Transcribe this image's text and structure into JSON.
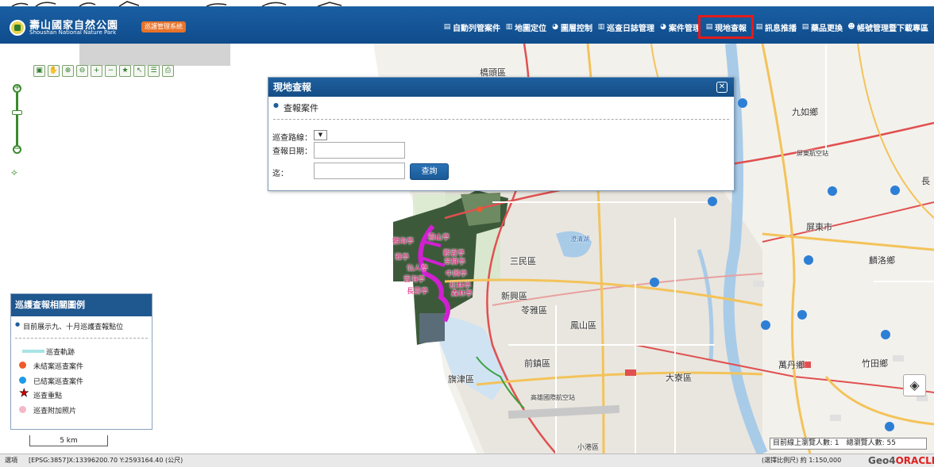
{
  "header": {
    "logo_title": "壽山國家自然公園",
    "logo_sub": "Shoushan National Nature Park",
    "system_badge": "巡護管理系統",
    "nav": [
      {
        "label": "自動列管案件",
        "icon": "document-icon"
      },
      {
        "label": "地圖定位",
        "icon": "bar-chart-icon"
      },
      {
        "label": "圖層控制",
        "icon": "pie-chart-icon"
      },
      {
        "label": "巡查日誌管理",
        "icon": "bar-chart-icon"
      },
      {
        "label": "案件管理",
        "icon": "pie-chart-icon"
      },
      {
        "label": "現地查報",
        "icon": "document-icon",
        "active": true
      },
      {
        "label": "訊息推播",
        "icon": "document-icon"
      },
      {
        "label": "藥品更換",
        "icon": "document-icon"
      },
      {
        "label": "帳號管理暨下載專區",
        "icon": "users-icon"
      }
    ]
  },
  "map": {
    "labels": {
      "qiaotou": "橋頭區",
      "jiuru": "九如鄉",
      "pingdong_airport": "屏東航空站",
      "chang": "長",
      "pingdong_city": "屏東市",
      "linluo": "麟洛鄉",
      "sanmin": "三民區",
      "xinxing": "新興區",
      "lingya": "苓雅區",
      "fengshan": "鳳山區",
      "qianzhen": "前鎮區",
      "cijin": "旗津區",
      "daliao": "大寮區",
      "wandan": "萬丹鄉",
      "zhutian": "竹田鄉",
      "kaohsiung_airport": "高雄國際航空站",
      "xiaogang": "小港區",
      "cheng": "澄清湖",
      "pavilions": [
        "觀海亭",
        "壽山亭",
        "雅亭",
        "觀雲亭",
        "仙人亭",
        "翠屏亭",
        "雲海亭",
        "中興亭",
        "長壽亭",
        "松林亭",
        "森林亭"
      ]
    }
  },
  "toolbar": {
    "tools": [
      "select-icon",
      "pan-icon",
      "zoom-in-icon",
      "zoom-out-icon",
      "plus-icon",
      "minus-icon",
      "bookmark-icon",
      "pointer-icon",
      "layers-icon",
      "print-icon"
    ]
  },
  "dialog": {
    "title": "現地查報",
    "close_symbol": "✕",
    "subtitle": "查報案件",
    "route_label": "巡查路線：",
    "route_value": "▼",
    "date_label": "查報日期：",
    "date_value": "",
    "to_label": "迄：",
    "to_value": "",
    "query_button": "查詢"
  },
  "legend": {
    "title": "巡護查報相關圖例",
    "note": "目前展示九、十月巡護查報點位",
    "items": [
      "巡查軌跡",
      "未結案巡查案件",
      "已結案巡查案件",
      "巡查重點",
      "巡查附加照片"
    ],
    "colors": {
      "track": "#a8e4e4",
      "open": "#f05a28",
      "closed": "#1e9be8",
      "key": "#cc0000",
      "photo": "#f5b8c8"
    }
  },
  "scale_bar": "5 km",
  "online_counter": "目前線上瀏覽人數: 1　總瀏覽人數: 55",
  "status": {
    "select": "選項",
    "coords": "[EPSG:3857]X:13396200.70 Y:2593164.40 (公尺)",
    "scale": "(選擇比例尺) 約 1:150,000",
    "brand_prefix": "Geo4",
    "brand_suffix": "ORACLE"
  }
}
